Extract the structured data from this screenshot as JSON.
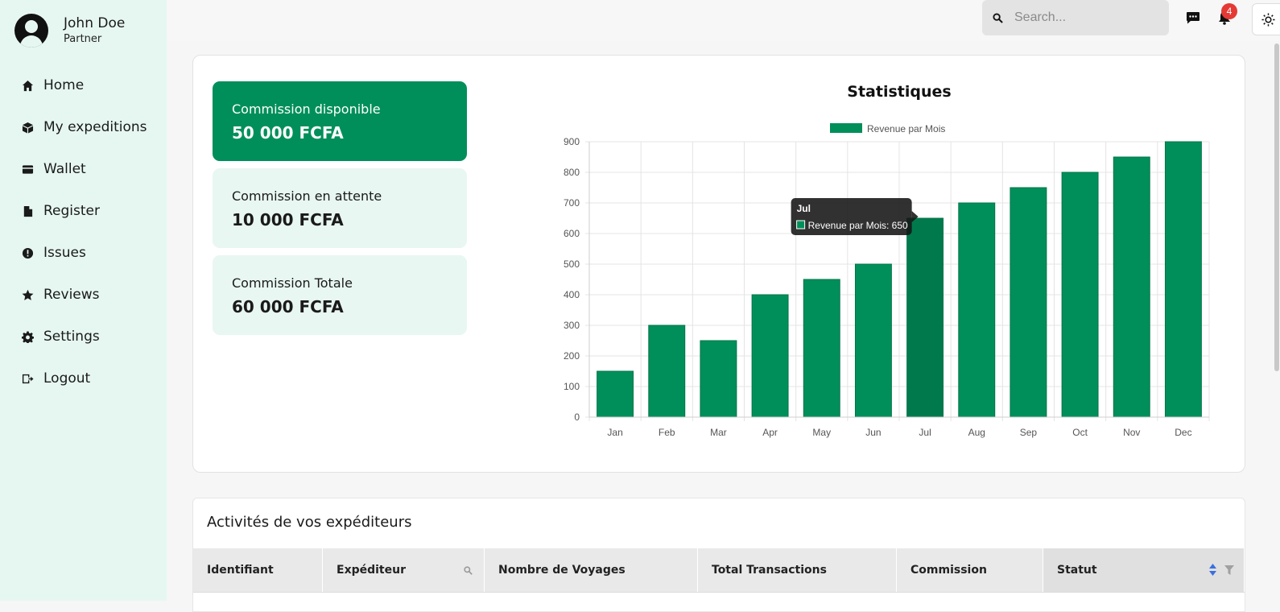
{
  "profile": {
    "name": "John Doe",
    "role": "Partner"
  },
  "nav": [
    {
      "label": "Home",
      "icon": "home-icon"
    },
    {
      "label": "My expeditions",
      "icon": "package-icon"
    },
    {
      "label": "Wallet",
      "icon": "wallet-icon"
    },
    {
      "label": "Register",
      "icon": "document-icon"
    },
    {
      "label": "Issues",
      "icon": "alert-icon"
    },
    {
      "label": "Reviews",
      "icon": "star-icon"
    },
    {
      "label": "Settings",
      "icon": "gear-icon"
    },
    {
      "label": "Logout",
      "icon": "logout-icon"
    }
  ],
  "topbar": {
    "search_placeholder": "Search...",
    "notifications_count": "4"
  },
  "stats": [
    {
      "label": "Commission disponible",
      "value": "50 000 FCFA"
    },
    {
      "label": "Commission en attente",
      "value": "10 000 FCFA"
    },
    {
      "label": "Commission Totale",
      "value": "60 000 FCFA"
    }
  ],
  "chart_data": {
    "type": "bar",
    "title": "Statistiques",
    "categories": [
      "Jan",
      "Feb",
      "Mar",
      "Apr",
      "May",
      "Jun",
      "Jul",
      "Aug",
      "Sep",
      "Oct",
      "Nov",
      "Dec"
    ],
    "series": [
      {
        "name": "Revenue par Mois",
        "values": [
          150,
          300,
          250,
          400,
          450,
          500,
          650,
          700,
          750,
          800,
          850,
          900
        ],
        "color": "#008f5a"
      }
    ],
    "ylim": [
      0,
      900
    ],
    "yticks": [
      0,
      100,
      200,
      300,
      400,
      500,
      600,
      700,
      800,
      900
    ],
    "legend": "top",
    "grid": true,
    "tooltip": {
      "category": "Jul",
      "text": "Revenue par Mois: 650"
    }
  },
  "table": {
    "title": "Activités de vos expéditeurs",
    "columns": [
      "Identifiant",
      "Expéditeur",
      "Nombre de Voyages",
      "Total Transactions",
      "Commission",
      "Statut"
    ]
  }
}
